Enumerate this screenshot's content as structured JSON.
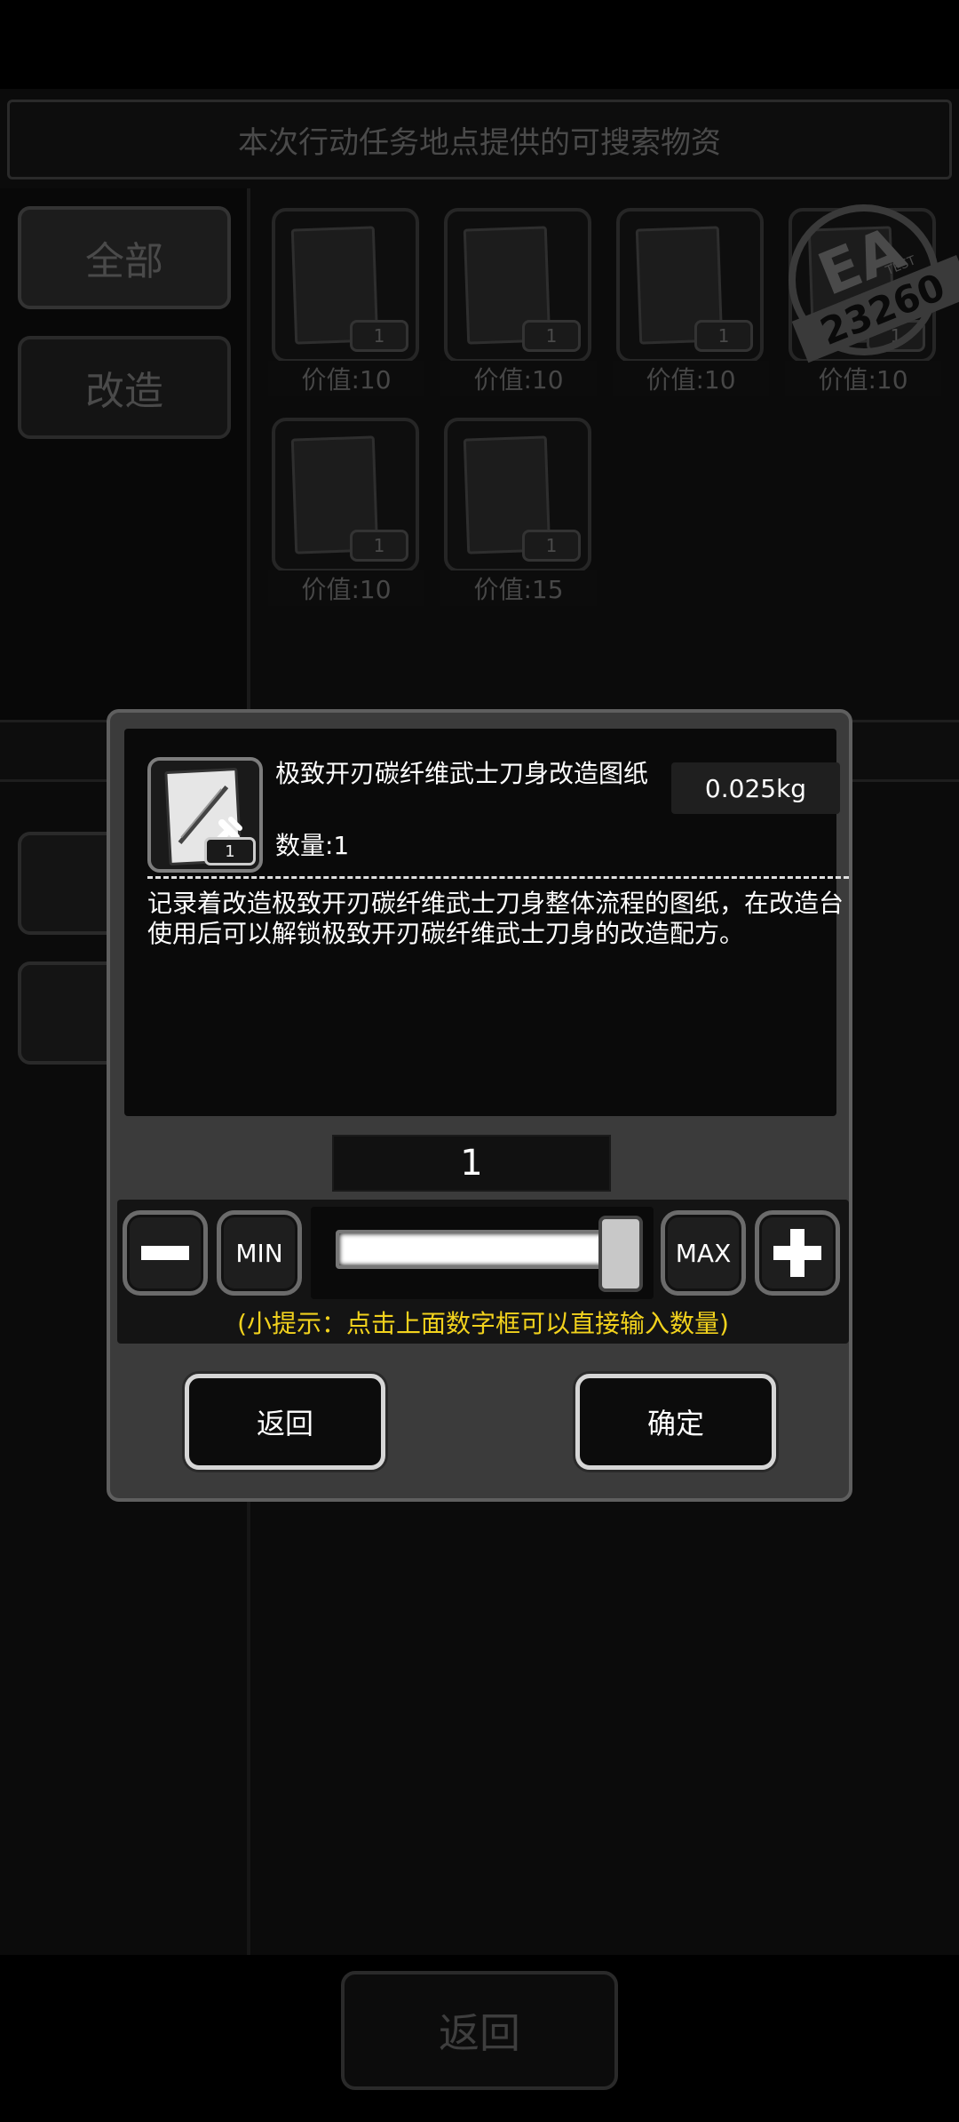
{
  "background": {
    "title": "本次行动任务地点提供的可搜索物资",
    "categories": [
      {
        "label": "全部"
      },
      {
        "label": "改造"
      }
    ],
    "items": [
      {
        "count": "1",
        "value": "价值:10"
      },
      {
        "count": "1",
        "value": "价值:10"
      },
      {
        "count": "1",
        "value": "价值:10"
      },
      {
        "count": "1",
        "value": "价值:10"
      },
      {
        "count": "1",
        "value": "价值:10"
      },
      {
        "count": "1",
        "value": "价值:15"
      }
    ],
    "stamp": {
      "big": "EA",
      "small": "TEST",
      "number": "23260"
    },
    "bottom_back_label": "返回"
  },
  "dialog": {
    "item_name": "极致开刃碳纤维武士刀身改造图纸",
    "item_badge": "1",
    "quantity_label": "数量:1",
    "weight": "0.025kg",
    "description": "记录着改造极致开刃碳纤维武士刀身整体流程的图纸，在改造台使用后可以解锁极致开刃碳纤维武士刀身的改造配方。",
    "quantity_value": "1",
    "min_label": "MIN",
    "max_label": "MAX",
    "slider_fraction": 1.0,
    "hint": "(小提示：点击上面数字框可以直接输入数量)",
    "back_label": "返回",
    "confirm_label": "确定"
  },
  "icons": {
    "minus": "minus-icon",
    "plus": "plus-icon",
    "wrench": "wrench-icon"
  }
}
